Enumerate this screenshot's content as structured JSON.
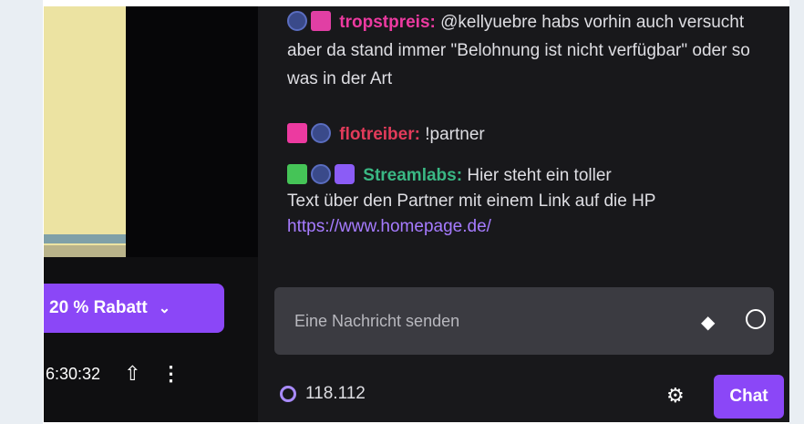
{
  "left_panel": {
    "promo_button": {
      "label": "20 % Rabatt",
      "chevron_icon": "chevron-down-icon"
    },
    "timebar": {
      "timestamp": "6:30:32",
      "share_icon": "share-icon",
      "more_icon": "more-vertical-icon"
    }
  },
  "chat": {
    "messages": [
      {
        "badges": [
          "prime-icon",
          "gift-icon"
        ],
        "username": "tropstpreis",
        "separator": ":",
        "text": " @kellyuebre habs vorhin auch versucht aber da stand immer \"Belohnung ist nicht verfügbar\" oder so was in der Art"
      },
      {
        "badges": [
          "heart-icon",
          "prime-icon"
        ],
        "username": "flotreiber",
        "separator": ":",
        "text": " !partner"
      },
      {
        "badges": [
          "sword-icon",
          "prime-icon",
          "verified-icon"
        ],
        "username": "Streamlabs",
        "separator": ":",
        "text_line1": " Hier steht ein toller",
        "text_line2": "Text über den Partner mit einem Link auf die HP",
        "link": "https://www.homepage.de/"
      }
    ],
    "input": {
      "placeholder": "Eine Nachricht senden",
      "bits_icon": "bits-icon",
      "emoji_icon": "emoji-icon"
    },
    "footer": {
      "points": "118.112",
      "points_icon": "channel-points-icon",
      "settings_icon": "gear-icon",
      "chat_button": "Chat"
    }
  },
  "colors": {
    "accent": "#8b47f7",
    "chat_bg": "#18181b",
    "user1": "#ec3aa0",
    "user2": "#e23b5a",
    "user3": "#3ab884",
    "link": "#a67bff"
  }
}
